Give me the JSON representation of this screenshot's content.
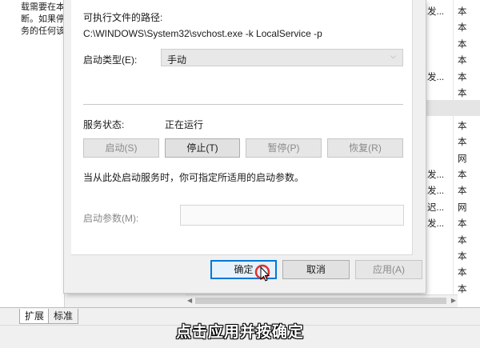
{
  "background": {
    "description_lines": [
      "载需要在本",
      "断。如果停",
      "务的任何该"
    ],
    "right_rows": [
      {
        "c1": "发...",
        "c2": "本",
        "selected": false
      },
      {
        "c1": "",
        "c2": "本",
        "selected": false
      },
      {
        "c1": "",
        "c2": "本",
        "selected": false
      },
      {
        "c1": "",
        "c2": "本",
        "selected": false
      },
      {
        "c1": "发...",
        "c2": "本",
        "selected": false
      },
      {
        "c1": "",
        "c2": "本",
        "selected": false
      },
      {
        "c1": "",
        "c2": "",
        "selected": true
      },
      {
        "c1": "",
        "c2": "本",
        "selected": false
      },
      {
        "c1": "",
        "c2": "本",
        "selected": false
      },
      {
        "c1": "",
        "c2": "网",
        "selected": false
      },
      {
        "c1": "发...",
        "c2": "本",
        "selected": false
      },
      {
        "c1": "发...",
        "c2": "本",
        "selected": false
      },
      {
        "c1": "迟...",
        "c2": "网",
        "selected": false
      },
      {
        "c1": "发...",
        "c2": "本",
        "selected": false
      },
      {
        "c1": "",
        "c2": "本",
        "selected": false
      },
      {
        "c1": "",
        "c2": "本",
        "selected": false
      },
      {
        "c1": "",
        "c2": "本",
        "selected": false
      },
      {
        "c1": "",
        "c2": "本",
        "selected": false
      }
    ],
    "tabs": [
      "扩展",
      "标准"
    ]
  },
  "dialog": {
    "path_label": "可执行文件的路径:",
    "path_value": "C:\\WINDOWS\\System32\\svchost.exe -k LocalService -p",
    "startup_type_label": "启动类型(E):",
    "startup_type_value": "手动",
    "service_status_label": "服务状态:",
    "service_status_value": "正在运行",
    "buttons": {
      "start": "启动(S)",
      "stop": "停止(T)",
      "pause": "暂停(P)",
      "resume": "恢复(R)"
    },
    "hint": "当从此处启动服务时，你可指定所适用的启动参数。",
    "params_label": "启动参数(M):",
    "params_value": "",
    "footer": {
      "ok": "确定",
      "cancel": "取消",
      "apply": "应用(A)"
    }
  },
  "subtitle": "点击应用并按确定",
  "colors": {
    "accent": "#0078d7",
    "cursor_ring": "#e03030"
  }
}
